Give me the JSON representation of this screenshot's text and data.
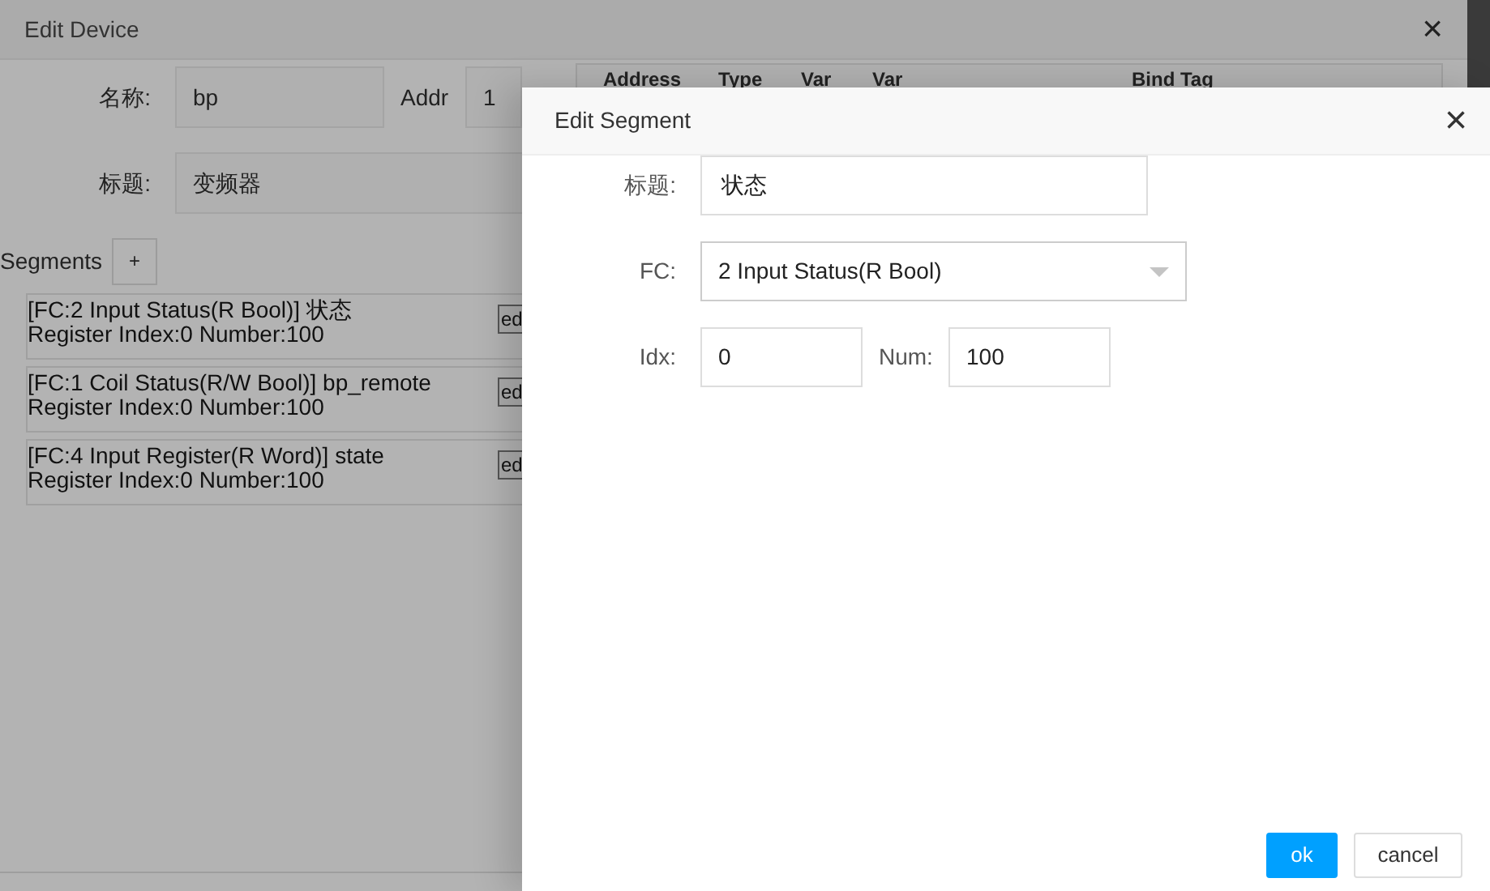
{
  "device_dialog": {
    "title": "Edit Device",
    "close": "×",
    "name_label": "名称:",
    "name_value": "bp",
    "addr_label": "Addr",
    "addr_value": "1",
    "title_label": "标题:",
    "title_value": "变频器",
    "segments_label": "Segments",
    "add_button": "+",
    "segments": [
      {
        "line1": "[FC:2 Input Status(R Bool)] 状态",
        "line2": "Register Index:0 Number:100",
        "edit": "ed"
      },
      {
        "line1": "[FC:1 Coil Status(R/W Bool)] bp_remote",
        "line2": "Register Index:0 Number:100",
        "edit": "ed"
      },
      {
        "line1": "[FC:4 Input Register(R Word)] state",
        "line2": "Register Index:0 Number:100",
        "edit": "ed"
      }
    ],
    "table": {
      "columns": [
        "Address",
        "Type",
        "Var",
        "Var",
        "Bind Tag"
      ]
    }
  },
  "segment_dialog": {
    "title": "Edit Segment",
    "close": "×",
    "title_label": "标题:",
    "title_value": "状态",
    "fc_label": "FC:",
    "fc_value": "2 Input Status(R Bool)",
    "idx_label": "Idx:",
    "idx_value": "0",
    "num_label": "Num:",
    "num_value": "100",
    "buttons": [
      {
        "label": "ok",
        "kind": "primary"
      },
      {
        "label": "cancel",
        "kind": "secondary"
      }
    ]
  }
}
